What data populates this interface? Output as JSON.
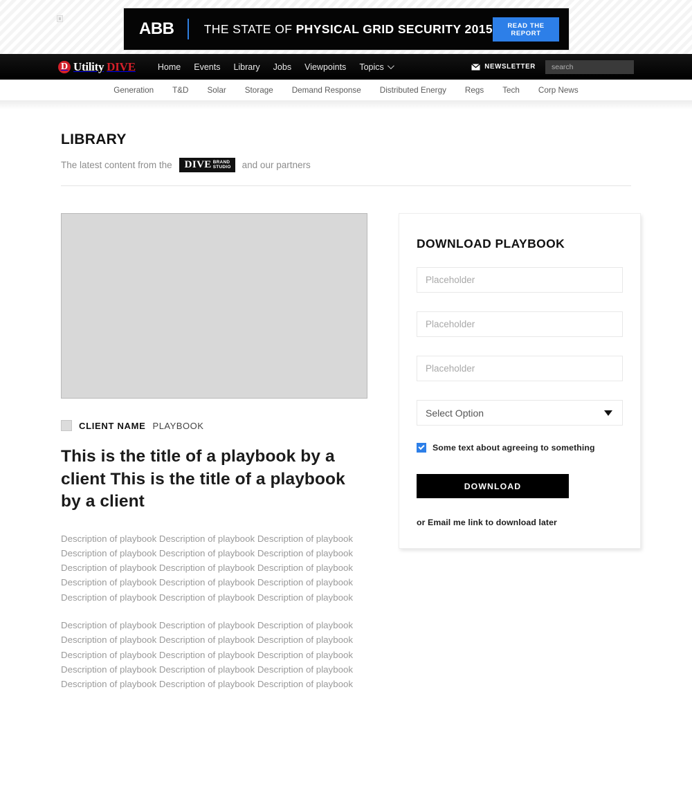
{
  "ad": {
    "logo_text": "ABB",
    "headline_prefix": "THE STATE OF ",
    "headline_bold": "PHYSICAL GRID SECURITY 2015",
    "cta_label": "READ THE REPORT",
    "cta_color": "#2d7fe8",
    "background_color": "#050505"
  },
  "header": {
    "brand": {
      "mark": "D",
      "name_light": "Utility",
      "name_accent": "DIVE",
      "accent_color": "#d4202a"
    },
    "nav_items": [
      {
        "label": "Home",
        "has_caret": false
      },
      {
        "label": "Events",
        "has_caret": false
      },
      {
        "label": "Library",
        "has_caret": false
      },
      {
        "label": "Jobs",
        "has_caret": false
      },
      {
        "label": "Viewpoints",
        "has_caret": false
      },
      {
        "label": "Topics",
        "has_caret": true
      }
    ],
    "newsletter_label": "NEWSLETTER",
    "newsletter_icon": "envelope-icon",
    "search": {
      "placeholder": "search",
      "value": "",
      "icon": "search-icon"
    }
  },
  "subnav": {
    "items": [
      {
        "label": "Generation"
      },
      {
        "label": "T&D"
      },
      {
        "label": "Solar"
      },
      {
        "label": "Storage"
      },
      {
        "label": "Demand Response"
      },
      {
        "label": "Distributed Energy"
      },
      {
        "label": "Regs"
      },
      {
        "label": "Tech"
      },
      {
        "label": "Corp News"
      }
    ]
  },
  "library": {
    "title": "LIBRARY",
    "subtitle_before": "The latest content from the",
    "badge": {
      "word": "DIVE",
      "line1": "BRAND",
      "line2": "STUDIO"
    },
    "subtitle_after": "and our partners"
  },
  "article": {
    "hero_image_alt": "playbook-cover-placeholder",
    "client_logo_alt": "client-logo-placeholder",
    "client_name": "CLIENT NAME",
    "content_type": "PLAYBOOK",
    "title": "This is the title of a playbook by a client This is the title of a playbook by a client",
    "paragraphs": [
      "Description of playbook Description of playbook Description of playbook Description of playbook Description of playbook Description of playbook Description of playbook Description of playbook Description of playbook Description of playbook Description of playbook Description of playbook Description of playbook Description of playbook Description of playbook",
      "Description of playbook Description of playbook Description of playbook Description of playbook Description of playbook Description of playbook Description of playbook Description of playbook Description of playbook Description of playbook Description of playbook Description of playbook Description of playbook Description of playbook Description of playbook"
    ]
  },
  "form": {
    "title": "DOWNLOAD PLAYBOOK",
    "fields": [
      {
        "placeholder": "Placeholder",
        "value": ""
      },
      {
        "placeholder": "Placeholder",
        "value": ""
      },
      {
        "placeholder": "Placeholder",
        "value": ""
      }
    ],
    "select": {
      "selected": "Select Option",
      "options": [
        "Select Option"
      ]
    },
    "consent": {
      "checked": true,
      "label": "Some text about agreeing to something",
      "color": "#2d7fe8"
    },
    "submit_label": "DOWNLOAD",
    "submit_color": "#000000",
    "alt_link_label": "or Email me link to download later"
  }
}
